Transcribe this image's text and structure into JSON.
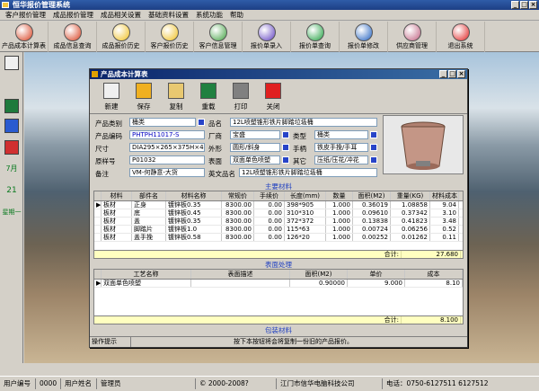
{
  "app": {
    "title": "恒华报价管理系统"
  },
  "menu": [
    "客户报价管理",
    "成品报价管理",
    "成品相关设置",
    "基础资料设置",
    "系统功能",
    "帮助"
  ],
  "toolbar": [
    {
      "label": "产品成本计算表",
      "color": "#d84020"
    },
    {
      "label": "成品信息查询",
      "color": "#d84020"
    },
    {
      "label": "成品报价历史",
      "color": "#f0c020"
    },
    {
      "label": "客户报价历史",
      "color": "#f0c020"
    },
    {
      "label": "客户信息管理",
      "color": "#40a040"
    },
    {
      "label": "报价单录入",
      "color": "#6040c0"
    },
    {
      "label": "报价单查询",
      "color": "#20a040"
    },
    {
      "label": "报价单修改",
      "color": "#2060c0"
    },
    {
      "label": "供应商管理",
      "color": "#c06080"
    },
    {
      "label": "退出系统",
      "color": "#e02020"
    }
  ],
  "sidebar": {
    "date_month": "7月",
    "date_day": "21",
    "weekday": "星期一"
  },
  "dialog": {
    "title": "产品成本计算表",
    "buttons": [
      {
        "label": "新建",
        "icon": "new-document-icon",
        "color": "#f0f0f0"
      },
      {
        "label": "保存",
        "icon": "save-icon",
        "color": "#f0b020"
      },
      {
        "label": "复制",
        "icon": "copy-icon",
        "color": "#e8c870"
      },
      {
        "label": "重载",
        "icon": "reload-icon",
        "color": "#208040"
      },
      {
        "label": "打印",
        "icon": "print-icon",
        "color": "#808080"
      },
      {
        "label": "关闭",
        "icon": "close-icon",
        "color": "#e02020"
      }
    ],
    "form": {
      "category_label": "产品类别",
      "category_value": "桶类",
      "code_label": "产品编码",
      "code_value": "PHTPH11017-S",
      "size_label": "尺寸",
      "size_value": "DIA295×265×375H×470XHmm",
      "ref_label": "原样号",
      "ref_value": "P01032",
      "note_label": "备注",
      "note_value": "VM-何静意-大货",
      "name_label": "品名",
      "name_value": "12L喷塑锥形铁片脚踏垃圾桶",
      "vendor_label": "厂商",
      "vendor_value": "宝盛",
      "shape_label": "外形",
      "shape_value": "圆形/斜身",
      "surface_label": "表面",
      "surface_value": "双面单色喷塑",
      "type_label": "类型",
      "type_value": "桶类",
      "handle_label": "手柄",
      "handle_value": "铁皮手挽/手耳",
      "other_label": "其它",
      "other_value": "压纸/压花/冲花",
      "en_label": "英文品名",
      "en_value": "12L喷塑锥形铁片脚踏垃圾桶"
    },
    "materials": {
      "section_title": "主要材料",
      "headers": [
        "材料",
        "部件名",
        "材料名称",
        "常规价",
        "手续价",
        "长度(mm)",
        "数量",
        "面积(M2)",
        "重量(KG)",
        "材料成本"
      ],
      "rows": [
        [
          "板材",
          "正身",
          "镀锌板0.35",
          "8300.00",
          "0.00",
          "398*905",
          "1.000",
          "0.36019",
          "1.08858",
          "9.04"
        ],
        [
          "板材",
          "底",
          "镀锌板0.45",
          "8300.00",
          "0.00",
          "310*310",
          "1.000",
          "0.09610",
          "0.37342",
          "3.10"
        ],
        [
          "板材",
          "盖",
          "镀锌板0.35",
          "8300.00",
          "0.00",
          "372*372",
          "1.000",
          "0.13838",
          "0.41823",
          "3.48"
        ],
        [
          "板材",
          "脚踏片",
          "镀锌板1.0",
          "8300.00",
          "0.00",
          "115*63",
          "1.000",
          "0.00724",
          "0.06256",
          "0.52"
        ],
        [
          "板材",
          "盖手挽",
          "镀锌板0.58",
          "8300.00",
          "0.00",
          "126*20",
          "1.000",
          "0.00252",
          "0.01262",
          "0.11"
        ]
      ],
      "total_label": "合计:",
      "total_value": "27.680"
    },
    "surface": {
      "section_title": "表面处理",
      "headers": [
        "工艺名称",
        "表面描述",
        "面积(M2)",
        "单价",
        "成本"
      ],
      "rows": [
        [
          "双面单色喷塑",
          "",
          "0.90000",
          "9.000",
          "8.10"
        ]
      ],
      "total_label": "合计:",
      "total_value": "8.100"
    },
    "packaging_title": "包装材料",
    "status_label": "操作提示",
    "status_text": "按下本按钮将会将复制一份旧的产品报价。"
  },
  "statusbar": {
    "user_code_label": "用户编号",
    "user_code": "0000",
    "user_name_label": "用户姓名",
    "user_name": "管理员",
    "copyright": "© 2000-2008?",
    "company": "江门市信华电脑科技公司",
    "phone": "电话：0750-6127511  6127512"
  }
}
